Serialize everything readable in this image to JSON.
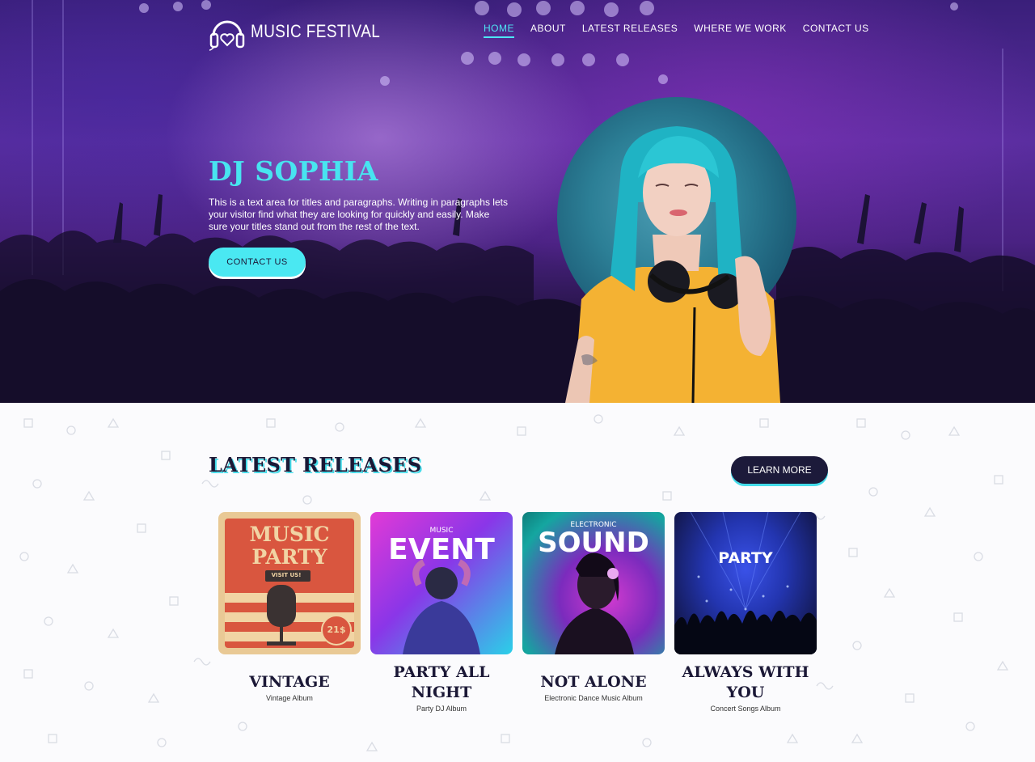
{
  "brand": {
    "name": "MUSIC FESTIVAL",
    "logo_icon": "headphones-heart-icon"
  },
  "nav": {
    "items": [
      {
        "label": "HOME",
        "active": true
      },
      {
        "label": "ABOUT",
        "active": false
      },
      {
        "label": "LATEST RELEASES",
        "active": false
      },
      {
        "label": "WHERE WE WORK",
        "active": false
      },
      {
        "label": "CONTACT US",
        "active": false
      }
    ]
  },
  "hero": {
    "title": "DJ SOPHIA",
    "text": "This is a text area for titles and paragraphs. Writing in paragraphs lets your visitor find what they are looking for quickly and easily. Make sure your titles stand out from the rest of the text.",
    "button_label": "CONTACT US"
  },
  "releases": {
    "title": "LATEST RELEASES",
    "button_label": "LEARN MORE",
    "albums": [
      {
        "title": "VINTAGE",
        "subtitle": "Vintage Album",
        "cover_lines": [
          "MUSIC",
          "PARTY"
        ],
        "cover_badge": "VISIT US!",
        "cover_price": "21$"
      },
      {
        "title": "PARTY ALL NIGHT",
        "subtitle": "Party DJ Album",
        "cover_small": "MUSIC",
        "cover_big": "EVENT"
      },
      {
        "title": "NOT ALONE",
        "subtitle": "Electronic Dance Music Album",
        "cover_small": "ELECTRONIC",
        "cover_big": "SOUND"
      },
      {
        "title": "ALWAYS WITH YOU",
        "subtitle": "Concert Songs Album",
        "cover_big": "PARTY"
      }
    ]
  },
  "colors": {
    "accent": "#4ae8f2",
    "dark": "#1c1a3a",
    "hero_purple": "#5a2ea0"
  }
}
